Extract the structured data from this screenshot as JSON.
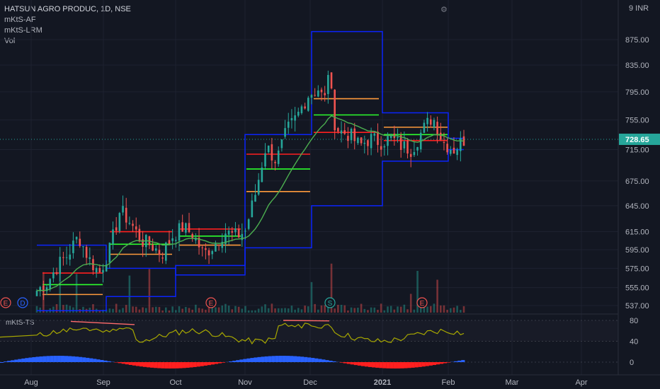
{
  "header": {
    "symbol_line": "HATSUN AGRO PRODUC, 1D, NSE",
    "indicators": [
      "mKtS-AF",
      "mKtS-LRM",
      "Vol"
    ],
    "currency": "9 INR",
    "oscillator_title": "mKtS-TS",
    "settings_icon": "gear-icon"
  },
  "colors": {
    "background": "#131722",
    "bull": "#26a69a",
    "bear": "#ef5350",
    "channel": "#0b24fb",
    "ema": "#4caf50",
    "level_red": "#ff1f1f",
    "level_green": "#2dff2d",
    "level_orange": "#ff9a3c",
    "oscillator_line": "#a8a800",
    "last_price_bg": "#26a69a"
  },
  "chart_data": [
    {
      "type": "candlestick",
      "title": "HATSUN AGRO PRODUC, 1D, NSE",
      "last_price": "728.65",
      "y_ticks": [
        "875.00",
        "835.00",
        "795.00",
        "755.00",
        "715.00",
        "675.00",
        "645.00",
        "615.00",
        "595.00",
        "575.00",
        "555.00",
        "537.00"
      ],
      "x_ticks": [
        "Aug",
        "Sep",
        "Oct",
        "Nov",
        "Dec",
        "2021",
        "Feb",
        "Mar",
        "Apr"
      ],
      "scale": "log",
      "ylim": [
        530,
        905
      ],
      "events": [
        "E",
        "D",
        "E",
        "S",
        "E"
      ],
      "series": [
        {
          "name": "Price",
          "description": "daily candles, approx. monthly price path",
          "values": [
            552,
            560,
            578,
            590,
            610,
            585,
            570,
            595,
            640,
            625,
            605,
            600,
            590,
            610,
            620,
            612,
            590,
            600,
            615,
            610,
            615,
            660,
            720,
            700,
            740,
            760,
            790,
            800,
            770,
            740,
            735,
            720,
            730,
            725,
            730,
            720,
            715,
            740,
            760,
            725,
            715,
            728
          ]
        }
      ]
    },
    {
      "type": "line",
      "title": "mKtS-TS",
      "y_ticks": [
        "80",
        "40",
        "0"
      ],
      "ylim": [
        -15,
        90
      ]
    }
  ]
}
